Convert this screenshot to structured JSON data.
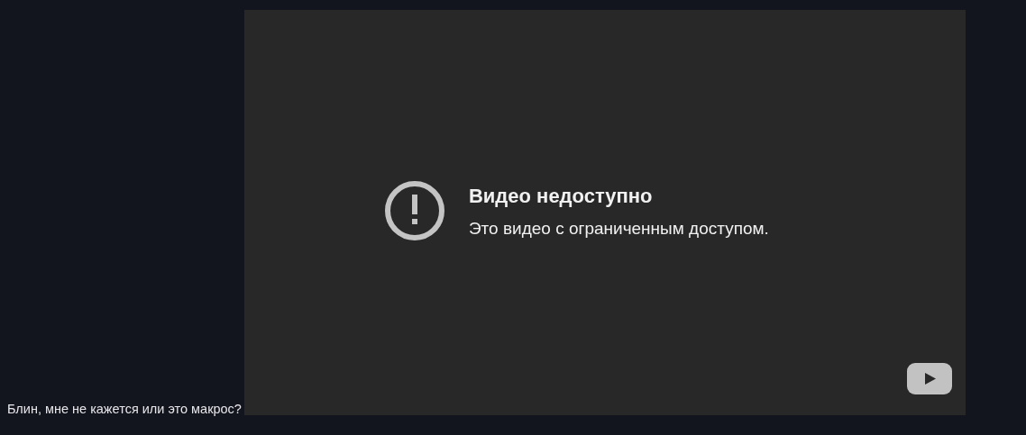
{
  "post_text": "Блин, мне не кажется или это макрос?",
  "video": {
    "title": "Видео недоступно",
    "message": "Это видео с ограниченным доступом."
  }
}
